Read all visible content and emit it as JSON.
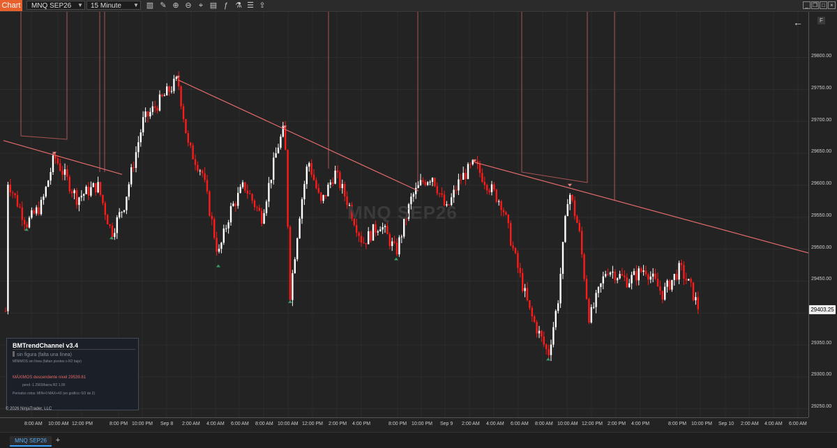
{
  "toolbar": {
    "chart_tab": "Chart",
    "instrument": "MNQ SEP26",
    "timeframe": "15 Minute",
    "icons": [
      "bar-chart-icon",
      "pencil-icon",
      "zoom-in-icon",
      "zoom-out-icon",
      "crosshair-icon",
      "properties-icon",
      "indicators-icon",
      "strategy-icon",
      "data-box-icon",
      "share-icon"
    ]
  },
  "window": {
    "controls": [
      "restore-icon",
      "maximize-icon",
      "close-icon"
    ]
  },
  "chart": {
    "watermark": "MNQ SEP26",
    "badge": "F",
    "last_price": "29403.25",
    "y_ticks": [
      "29800.00",
      "29750.00",
      "29700.00",
      "29650.00",
      "29600.00",
      "29550.00",
      "29500.00",
      "29450.00",
      "29350.00",
      "29300.00",
      "29250.00"
    ],
    "x_ticks": [
      "8:00 AM",
      "10:00 AM",
      "12:00 PM",
      "8:00 PM",
      "10:00 PM",
      "Sep 8",
      "2:00 AM",
      "4:00 AM",
      "6:00 AM",
      "8:00 AM",
      "10:00 AM",
      "12:00 PM",
      "2:00 PM",
      "4:00 PM",
      "8:00 PM",
      "10:00 PM",
      "Sep 9",
      "2:00 AM",
      "4:00 AM",
      "6:00 AM",
      "8:00 AM",
      "10:00 AM",
      "12:00 PM",
      "2:00 PM",
      "4:00 PM",
      "8:00 PM",
      "10:00 PM",
      "Sep 10",
      "2:00 AM",
      "4:00 AM",
      "6:00 AM"
    ],
    "colors": {
      "up": "#ffffff",
      "down": "#ff1a1a",
      "trend": "#e36a6a",
      "pivot_low": "#3a9a6a",
      "pivot_high": "#e38080"
    }
  },
  "chart_data": {
    "type": "candlestick",
    "y_range": [
      29225,
      29850
    ],
    "trendlines": [
      {
        "name": "MAXIMOS",
        "from": [
          5,
          29670
        ],
        "to": [
          175,
          29617
        ]
      },
      {
        "name": "MAXIMOS",
        "from": [
          255,
          29765
        ],
        "to": [
          600,
          29591
        ]
      },
      {
        "name": "MAXIMOS",
        "from": [
          680,
          29636
        ],
        "to": [
          1159,
          29494
        ]
      }
    ],
    "pivot_highs": [
      [
        78,
        29648
      ],
      [
        255,
        29767
      ],
      [
        408,
        29689
      ],
      [
        680,
        29636
      ],
      [
        817,
        29598
      ]
    ],
    "pivot_lows": [
      [
        38,
        29533
      ],
      [
        160,
        29520
      ],
      [
        313,
        29476
      ],
      [
        416,
        29420
      ],
      [
        568,
        29487
      ],
      [
        786,
        29330
      ]
    ]
  },
  "indicator": {
    "title": "BMTrendChannel v3.4",
    "line1": "sin figura (falta una línea)",
    "line2": "MÍNIMOS  sin línea (faltan pivotes o R2 bajo)",
    "line3": "MÁXIMOS  descendente   nivel 29539.81",
    "line4": "pend -1.2903/barra    R2 1.00",
    "line5": "Periodos rotos: MIN+0  MAX+43  (en gráfico: 0/2 de 2)",
    "copyright": "© 2026 NinjaTrader, LLC"
  },
  "tabs": {
    "active": "MNQ SEP26",
    "add": "+"
  }
}
